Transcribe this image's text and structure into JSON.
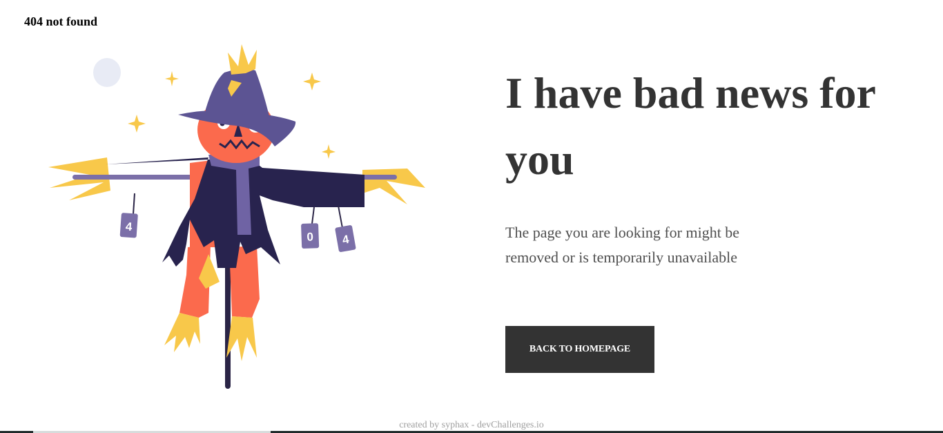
{
  "brand": {
    "title": "404 not found"
  },
  "main": {
    "headline": "I have bad news for you",
    "message": "The page you are looking for might be removed or is temporarily unavailable",
    "cta_label": "BACK TO HOMEPAGE"
  },
  "illustration": {
    "icon": "scarecrow-illustration",
    "cans": [
      "4",
      "0",
      "4"
    ]
  },
  "footer": {
    "credit": "created by syphax - devChallenges.io"
  },
  "colors": {
    "heading": "#333333",
    "body_text": "#4f4f4f",
    "button_bg": "#333333",
    "button_text": "#ffffff",
    "footer_text": "#a0a0a0"
  }
}
